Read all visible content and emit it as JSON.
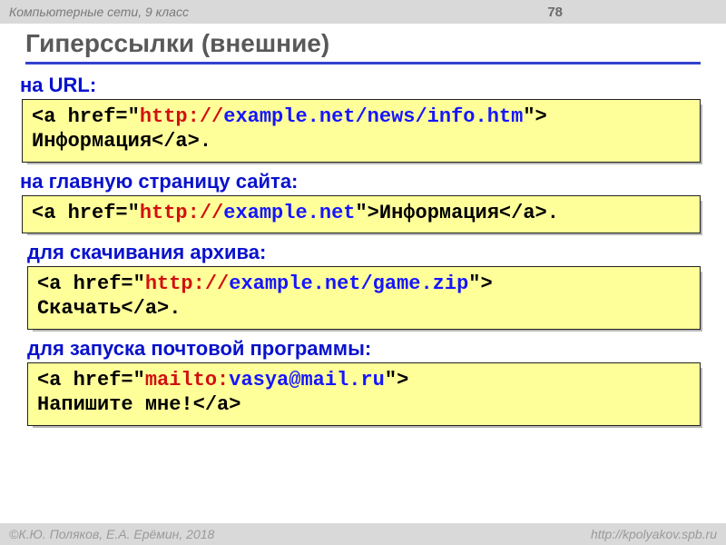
{
  "header": {
    "course": "Компьютерные сети, 9 класс",
    "page": "78"
  },
  "title": {
    "bold": "Гиперссылки",
    "rest": " (внешние)"
  },
  "sections": {
    "s1": {
      "label": "на URL:",
      "code": [
        {
          "t": "<a href=\"",
          "c": "black"
        },
        {
          "t": "http://",
          "c": "red"
        },
        {
          "t": "example.net/news/info.htm",
          "c": "blue"
        },
        {
          "t": "\">",
          "c": "black"
        },
        {
          "t": "\n",
          "c": "black"
        },
        {
          "t": "Информация</a>.",
          "c": "black"
        }
      ]
    },
    "s2": {
      "label": "на главную страницу сайта:",
      "code": [
        {
          "t": "<a href=\"",
          "c": "black"
        },
        {
          "t": "http://",
          "c": "red"
        },
        {
          "t": "example.net",
          "c": "blue"
        },
        {
          "t": "\">Информация</a>.",
          "c": "black"
        }
      ]
    },
    "s3": {
      "label": "для скачивания архива:",
      "code": [
        {
          "t": "<a href=\"",
          "c": "black"
        },
        {
          "t": "http://",
          "c": "red"
        },
        {
          "t": "example.net/game.zip",
          "c": "blue"
        },
        {
          "t": "\">",
          "c": "black"
        },
        {
          "t": "\n",
          "c": "black"
        },
        {
          "t": "Скачать</a>.",
          "c": "black"
        }
      ]
    },
    "s4": {
      "label": "для запуска почтовой программы:",
      "code": [
        {
          "t": "<a href=\"",
          "c": "black"
        },
        {
          "t": "mailto:",
          "c": "red"
        },
        {
          "t": "vasya@mail.ru",
          "c": "blue"
        },
        {
          "t": "\">",
          "c": "black"
        },
        {
          "t": "\n",
          "c": "black"
        },
        {
          "t": "Напишите мне!</a>",
          "c": "black"
        }
      ]
    }
  },
  "footer": {
    "left": "К.Ю. Поляков, Е.А. Ерёмин, 2018",
    "right": "http://kpolyakov.spb.ru"
  }
}
